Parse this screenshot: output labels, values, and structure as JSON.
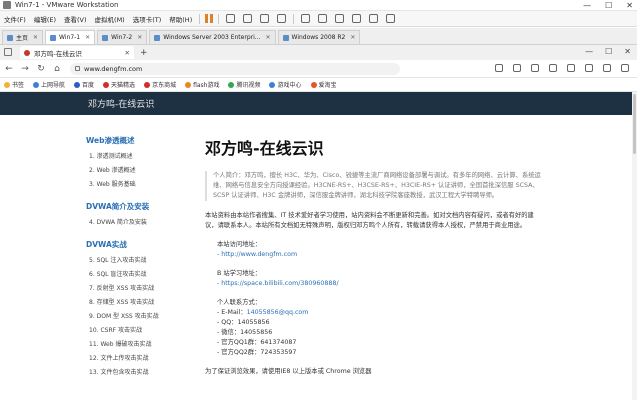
{
  "window": {
    "title": "Win7-1 - VMware Workstation",
    "controls": [
      "—",
      "☐",
      "✕"
    ]
  },
  "menubar": {
    "items": [
      "文件(F)",
      "编辑(E)",
      "查看(V)",
      "虚拟机(M)",
      "选项卡(T)",
      "帮助(H)"
    ]
  },
  "vm_tabs": [
    {
      "label": "主页",
      "active": false
    },
    {
      "label": "Win7-1",
      "active": true
    },
    {
      "label": "Win7-2",
      "active": false
    },
    {
      "label": "Windows Server 2003 Enterpri...",
      "active": false
    },
    {
      "label": "Windows 2008 R2",
      "active": false
    }
  ],
  "browser": {
    "tab_title": "邓方鸣-在线云识",
    "url": "www.dengfm.com",
    "bookmarks": [
      {
        "label": "书签",
        "color": "#f2b233"
      },
      {
        "label": "上网导航",
        "color": "#3b82d6"
      },
      {
        "label": "百度",
        "color": "#2a5ec7"
      },
      {
        "label": "天猫精选",
        "color": "#d42b2b"
      },
      {
        "label": "京东商城",
        "color": "#d42b2b"
      },
      {
        "label": "flash游戏",
        "color": "#e58a1f"
      },
      {
        "label": "腾讯视频",
        "color": "#2fa84f"
      },
      {
        "label": "游戏中心",
        "color": "#3b82d6"
      },
      {
        "label": "爱淘宝",
        "color": "#e5552b"
      }
    ]
  },
  "page": {
    "site_title": "邓方鸣-在线云识",
    "heading": "邓方鸣-在线云识",
    "sidebar": [
      {
        "section": "Web渗透概述",
        "items": [
          "1. 渗透测试概述",
          "2. Web 渗透概述",
          "3. Web 服务基础"
        ]
      },
      {
        "section": "DVWA简介及安装",
        "items": [
          "4. DVWA 简介及安装"
        ]
      },
      {
        "section": "DVWA实战",
        "items": [
          "5. SQL 注入攻击实战",
          "6. SQL 盲注攻击实战",
          "7. 反射型 XSS 攻击实战",
          "8. 存储型 XSS 攻击实战",
          "9. DOM 型 XSS 攻击实战",
          "10. CSRF 攻击实战",
          "11. Web 爆破攻击实战",
          "12. 文件上传攻击实战",
          "13. 文件包含攻击实战"
        ]
      }
    ],
    "intro": "个人简介：邓方鸣，擅长 H3C、华为、Cisco、锐捷等主流厂商网络设备部署与调试。有多年的网络、云计算、系统运维、网络与信息安全方向授课经验。H3CNE-RS+、H3CSE-RS+、H3CIE-RS+ 认证讲师，全国首批深信服 SCSA、SCSP 认证讲师、H3C 金牌讲师，深信服金牌讲师，湖北科技学院客座教授，武汉工程大学特聘导师。",
    "para": "本站资料由本站作者搜集、IT 技术爱好者学习使用，站内资料会不断更新和完善。如对文档内容有疑问，或者有好的建议，请联系本人。本站所有文档如无特殊声明，版权归邓方鸣个人所有，转载请获得本人授权，严禁用于商业用途。",
    "site_addr_label": "本站访问地址：",
    "site_addr": "- http://www.dengfm.com",
    "bili_label": "B 站学习地址：",
    "bili_addr": "- https://space.bilibili.com/380960888/",
    "contact_label": "个人联系方式：",
    "email_prefix": "- E-Mail：",
    "email": "14055856@qq.com",
    "qq": "- QQ：14055856",
    "wechat": "- 微信：14055856",
    "qq_group1": "- 官方QQ1群：641374087",
    "qq_group2": "- 官方QQ2群：724353597",
    "footer_note": "为了保证浏览效果，请使用IE8 以上版本或 Chrome 浏览器"
  }
}
